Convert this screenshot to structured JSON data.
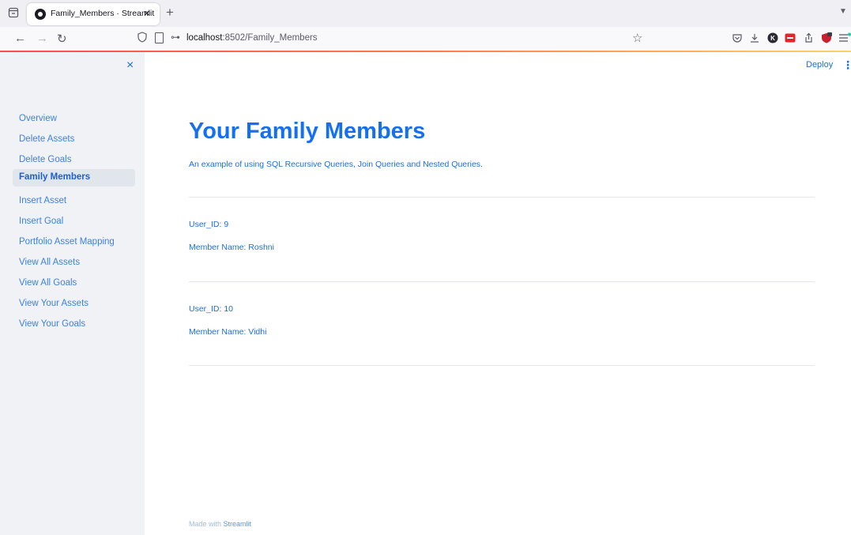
{
  "browser": {
    "tab_title": "Family_Members · Streamlit",
    "tab_close": "×",
    "new_tab": "+",
    "url_host": "localhost",
    "url_path": ":8502/Family_Members",
    "icons": [
      "tab-list-icon",
      "back-icon",
      "forward-icon",
      "reload-icon",
      "shield-icon",
      "page-icon",
      "key-icon",
      "bookmark-star-icon",
      "pocket-icon",
      "download-icon",
      "extension-k-icon",
      "extension-red-icon",
      "share-icon",
      "extension-shield-icon",
      "menu-icon"
    ]
  },
  "sidebar": {
    "close": "×",
    "items": [
      {
        "label": "Overview",
        "active": false
      },
      {
        "label": "Delete Assets",
        "active": false
      },
      {
        "label": "Delete Goals",
        "active": false
      },
      {
        "label": "Family Members",
        "active": true
      },
      {
        "label": "Insert Asset",
        "active": false
      },
      {
        "label": "Insert Goal",
        "active": false
      },
      {
        "label": "Portfolio Asset Mapping",
        "active": false
      },
      {
        "label": "View All Assets",
        "active": false
      },
      {
        "label": "View All Goals",
        "active": false
      },
      {
        "label": "View Your Assets",
        "active": false
      },
      {
        "label": "View Your Goals",
        "active": false
      }
    ]
  },
  "header": {
    "deploy_label": "Deploy",
    "menu_label": "⋮"
  },
  "main": {
    "title": "Your Family Members",
    "subtitle": "An example of using SQL Recursive Queries, Join Queries and Nested Queries.",
    "members": [
      {
        "user_id": "User_ID: 9",
        "member_name": "Member Name: Roshni"
      },
      {
        "user_id": "User_ID: 10",
        "member_name": "Member Name: Vidhi"
      }
    ]
  },
  "footer": {
    "prefix": "Made with ",
    "link": "Streamlit"
  },
  "colors": {
    "accent": "#1570ef",
    "link": "#1c6fd9",
    "sidebar_bg": "#f0f2f6"
  }
}
